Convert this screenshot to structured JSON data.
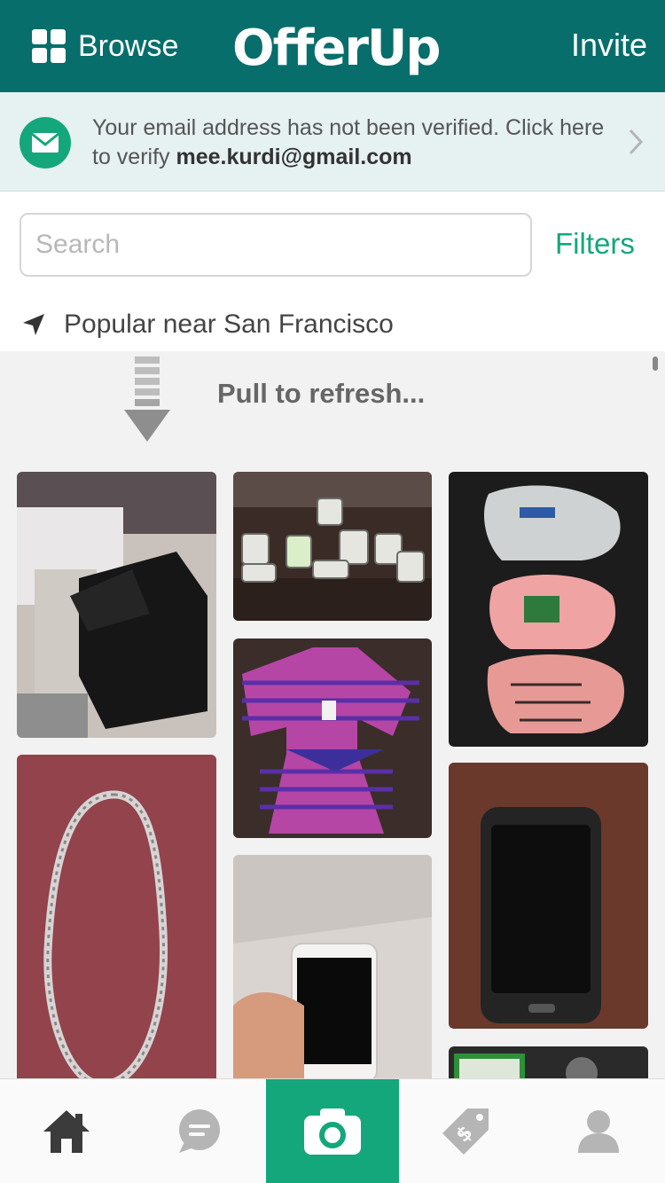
{
  "header": {
    "browse_label": "Browse",
    "logo_text": "OfferUp",
    "invite_label": "Invite",
    "background": "#076e6b"
  },
  "verify_banner": {
    "text_prefix": "Your email address has not been verified. Click here to verify ",
    "email": "mee.kurdi@gmail.com"
  },
  "search": {
    "placeholder": "Search",
    "value": "",
    "filters_label": "Filters"
  },
  "location": {
    "label": "Popular near San Francisco"
  },
  "feed": {
    "pull_to_refresh": "Pull to refresh...",
    "items": [
      {
        "name": "listing-black-sneakers"
      },
      {
        "name": "listing-watches"
      },
      {
        "name": "listing-beanies"
      },
      {
        "name": "listing-striped-tracksuit"
      },
      {
        "name": "listing-silver-chain"
      },
      {
        "name": "listing-smartphone-case"
      },
      {
        "name": "listing-white-iphone"
      },
      {
        "name": "listing-game-console"
      }
    ]
  },
  "tabbar": {
    "tabs": [
      {
        "name": "home",
        "icon": "home-icon"
      },
      {
        "name": "messages",
        "icon": "chat-icon"
      },
      {
        "name": "post",
        "icon": "camera-icon",
        "active": true
      },
      {
        "name": "selling",
        "icon": "price-tag-icon"
      },
      {
        "name": "profile",
        "icon": "profile-icon"
      }
    ],
    "accent": "#14a77c"
  }
}
